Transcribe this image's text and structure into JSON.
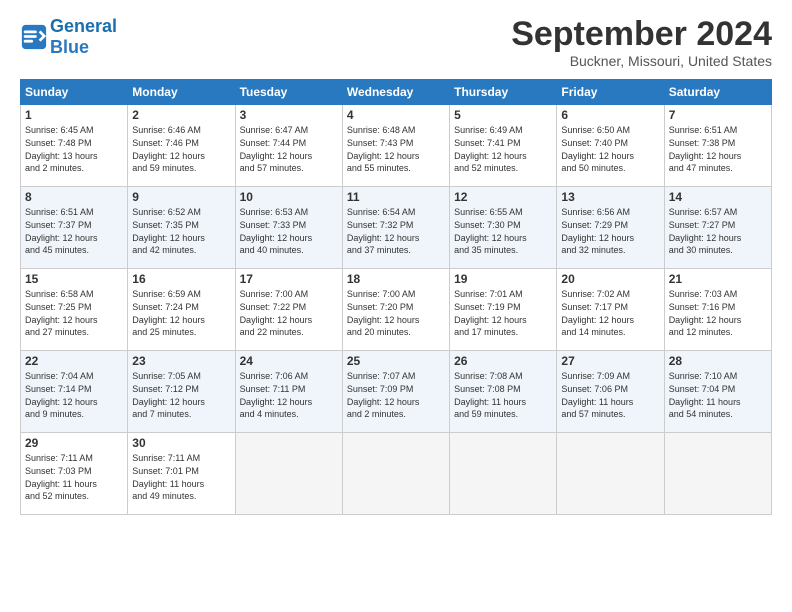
{
  "logo": {
    "text_general": "General",
    "text_blue": "Blue"
  },
  "header": {
    "month": "September 2024",
    "location": "Buckner, Missouri, United States"
  },
  "days_of_week": [
    "Sunday",
    "Monday",
    "Tuesday",
    "Wednesday",
    "Thursday",
    "Friday",
    "Saturday"
  ],
  "weeks": [
    [
      {
        "day": "1",
        "lines": [
          "Sunrise: 6:45 AM",
          "Sunset: 7:48 PM",
          "Daylight: 13 hours",
          "and 2 minutes."
        ]
      },
      {
        "day": "2",
        "lines": [
          "Sunrise: 6:46 AM",
          "Sunset: 7:46 PM",
          "Daylight: 12 hours",
          "and 59 minutes."
        ]
      },
      {
        "day": "3",
        "lines": [
          "Sunrise: 6:47 AM",
          "Sunset: 7:44 PM",
          "Daylight: 12 hours",
          "and 57 minutes."
        ]
      },
      {
        "day": "4",
        "lines": [
          "Sunrise: 6:48 AM",
          "Sunset: 7:43 PM",
          "Daylight: 12 hours",
          "and 55 minutes."
        ]
      },
      {
        "day": "5",
        "lines": [
          "Sunrise: 6:49 AM",
          "Sunset: 7:41 PM",
          "Daylight: 12 hours",
          "and 52 minutes."
        ]
      },
      {
        "day": "6",
        "lines": [
          "Sunrise: 6:50 AM",
          "Sunset: 7:40 PM",
          "Daylight: 12 hours",
          "and 50 minutes."
        ]
      },
      {
        "day": "7",
        "lines": [
          "Sunrise: 6:51 AM",
          "Sunset: 7:38 PM",
          "Daylight: 12 hours",
          "and 47 minutes."
        ]
      }
    ],
    [
      {
        "day": "8",
        "lines": [
          "Sunrise: 6:51 AM",
          "Sunset: 7:37 PM",
          "Daylight: 12 hours",
          "and 45 minutes."
        ]
      },
      {
        "day": "9",
        "lines": [
          "Sunrise: 6:52 AM",
          "Sunset: 7:35 PM",
          "Daylight: 12 hours",
          "and 42 minutes."
        ]
      },
      {
        "day": "10",
        "lines": [
          "Sunrise: 6:53 AM",
          "Sunset: 7:33 PM",
          "Daylight: 12 hours",
          "and 40 minutes."
        ]
      },
      {
        "day": "11",
        "lines": [
          "Sunrise: 6:54 AM",
          "Sunset: 7:32 PM",
          "Daylight: 12 hours",
          "and 37 minutes."
        ]
      },
      {
        "day": "12",
        "lines": [
          "Sunrise: 6:55 AM",
          "Sunset: 7:30 PM",
          "Daylight: 12 hours",
          "and 35 minutes."
        ]
      },
      {
        "day": "13",
        "lines": [
          "Sunrise: 6:56 AM",
          "Sunset: 7:29 PM",
          "Daylight: 12 hours",
          "and 32 minutes."
        ]
      },
      {
        "day": "14",
        "lines": [
          "Sunrise: 6:57 AM",
          "Sunset: 7:27 PM",
          "Daylight: 12 hours",
          "and 30 minutes."
        ]
      }
    ],
    [
      {
        "day": "15",
        "lines": [
          "Sunrise: 6:58 AM",
          "Sunset: 7:25 PM",
          "Daylight: 12 hours",
          "and 27 minutes."
        ]
      },
      {
        "day": "16",
        "lines": [
          "Sunrise: 6:59 AM",
          "Sunset: 7:24 PM",
          "Daylight: 12 hours",
          "and 25 minutes."
        ]
      },
      {
        "day": "17",
        "lines": [
          "Sunrise: 7:00 AM",
          "Sunset: 7:22 PM",
          "Daylight: 12 hours",
          "and 22 minutes."
        ]
      },
      {
        "day": "18",
        "lines": [
          "Sunrise: 7:00 AM",
          "Sunset: 7:20 PM",
          "Daylight: 12 hours",
          "and 20 minutes."
        ]
      },
      {
        "day": "19",
        "lines": [
          "Sunrise: 7:01 AM",
          "Sunset: 7:19 PM",
          "Daylight: 12 hours",
          "and 17 minutes."
        ]
      },
      {
        "day": "20",
        "lines": [
          "Sunrise: 7:02 AM",
          "Sunset: 7:17 PM",
          "Daylight: 12 hours",
          "and 14 minutes."
        ]
      },
      {
        "day": "21",
        "lines": [
          "Sunrise: 7:03 AM",
          "Sunset: 7:16 PM",
          "Daylight: 12 hours",
          "and 12 minutes."
        ]
      }
    ],
    [
      {
        "day": "22",
        "lines": [
          "Sunrise: 7:04 AM",
          "Sunset: 7:14 PM",
          "Daylight: 12 hours",
          "and 9 minutes."
        ]
      },
      {
        "day": "23",
        "lines": [
          "Sunrise: 7:05 AM",
          "Sunset: 7:12 PM",
          "Daylight: 12 hours",
          "and 7 minutes."
        ]
      },
      {
        "day": "24",
        "lines": [
          "Sunrise: 7:06 AM",
          "Sunset: 7:11 PM",
          "Daylight: 12 hours",
          "and 4 minutes."
        ]
      },
      {
        "day": "25",
        "lines": [
          "Sunrise: 7:07 AM",
          "Sunset: 7:09 PM",
          "Daylight: 12 hours",
          "and 2 minutes."
        ]
      },
      {
        "day": "26",
        "lines": [
          "Sunrise: 7:08 AM",
          "Sunset: 7:08 PM",
          "Daylight: 11 hours",
          "and 59 minutes."
        ]
      },
      {
        "day": "27",
        "lines": [
          "Sunrise: 7:09 AM",
          "Sunset: 7:06 PM",
          "Daylight: 11 hours",
          "and 57 minutes."
        ]
      },
      {
        "day": "28",
        "lines": [
          "Sunrise: 7:10 AM",
          "Sunset: 7:04 PM",
          "Daylight: 11 hours",
          "and 54 minutes."
        ]
      }
    ],
    [
      {
        "day": "29",
        "lines": [
          "Sunrise: 7:11 AM",
          "Sunset: 7:03 PM",
          "Daylight: 11 hours",
          "and 52 minutes."
        ]
      },
      {
        "day": "30",
        "lines": [
          "Sunrise: 7:11 AM",
          "Sunset: 7:01 PM",
          "Daylight: 11 hours",
          "and 49 minutes."
        ]
      },
      null,
      null,
      null,
      null,
      null
    ]
  ]
}
